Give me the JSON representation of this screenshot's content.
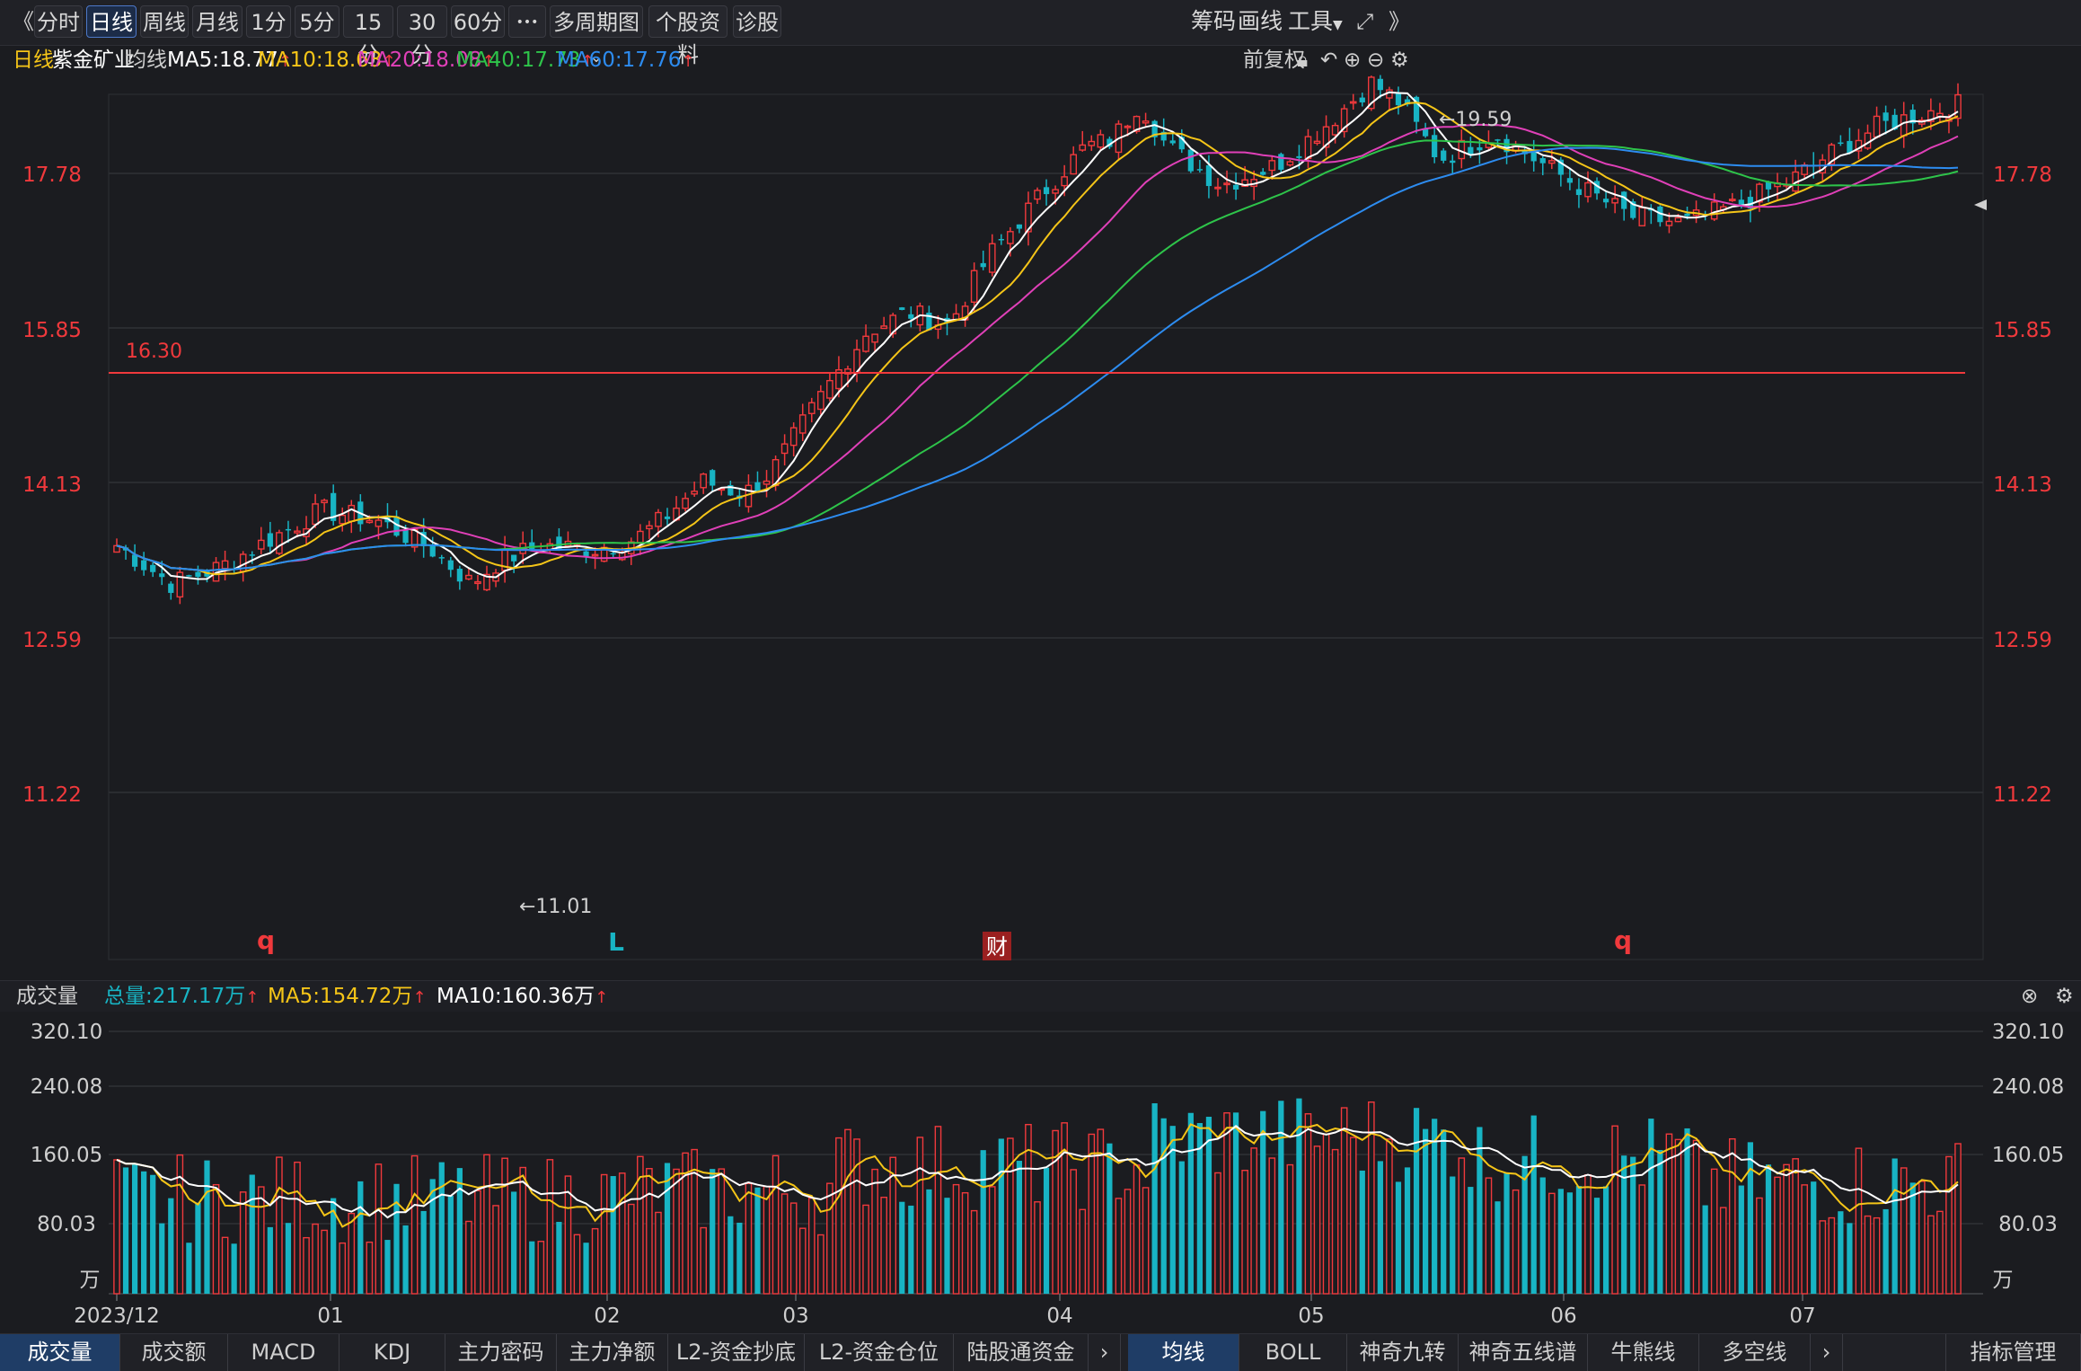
{
  "topbar": {
    "back_icon": "《",
    "tabs": [
      "分时",
      "日线",
      "周线",
      "月线",
      "1分",
      "5分",
      "15分",
      "30分",
      "60分"
    ],
    "active_tab": "日线",
    "more_label": "•••",
    "multi_period": "多周期图",
    "stock_info": "个股资料",
    "diagnose": "诊股",
    "chips": "筹码",
    "draw": "画线",
    "tools": "工具",
    "expand_icon": "⤢",
    "collapse_icon": "》"
  },
  "info": {
    "period": "日线",
    "stock": "紫金矿业",
    "avg_label": "均线",
    "ma5": "MA5:18.77",
    "ma10": "MA10:18.63",
    "ma20": "MA20:18.08",
    "ma40": "MA40:17.73",
    "ma60": "MA60:17.76",
    "adjust": "前复权"
  },
  "colors": {
    "up": "#f0393c",
    "down": "#18b4c4",
    "ma5": "#ffffff",
    "ma10": "#f5c518",
    "ma20": "#e040b8",
    "ma40": "#2ec44a",
    "ma60": "#2d8cf0",
    "grid": "#3a3b40"
  },
  "price_axis": {
    "ticks": [
      "17.78",
      "15.85",
      "14.13",
      "12.59",
      "11.22"
    ]
  },
  "annotations": {
    "high": "←19.59",
    "low": "←11.01",
    "hline": "16.30",
    "markers": [
      "q",
      "L",
      "财",
      "q"
    ]
  },
  "volume": {
    "title": "成交量",
    "total": "总量:217.17万",
    "ma5": "MA5:154.72万",
    "ma10": "MA10:160.36万",
    "ticks": [
      "320.10",
      "240.08",
      "160.05",
      "80.03"
    ],
    "unit": "万"
  },
  "x_axis": {
    "labels": [
      "2023/12",
      "01",
      "02",
      "03",
      "04",
      "05",
      "06",
      "07"
    ]
  },
  "bottom_tabs_left": [
    "成交量",
    "成交额",
    "MACD",
    "KDJ",
    "主力密码",
    "主力净额",
    "L2-资金抄底",
    "L2-资金仓位",
    "陆股通资金"
  ],
  "bottom_tabs_right": [
    "均线",
    "BOLL",
    "神奇九转",
    "神奇五线谱",
    "牛熊线",
    "多空线"
  ],
  "indicator_manage": "指标管理",
  "chart_data": {
    "type": "candlestick",
    "series_count": 205,
    "price_ylim": [
      10.8,
      19.8
    ],
    "volume_ylim": [
      0,
      330
    ],
    "hline_value": 16.3,
    "high_value": 19.59,
    "low_value": 11.01
  }
}
